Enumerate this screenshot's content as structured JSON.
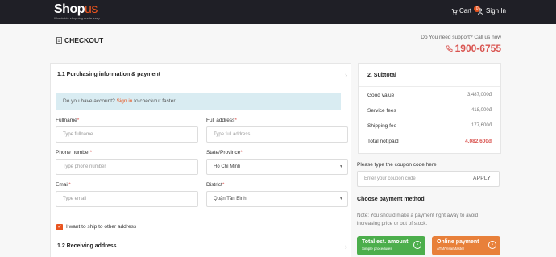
{
  "header": {
    "logo_main": "Sh",
    "logo_o": "o",
    "logo_p": "p",
    "logo_us": "us",
    "tagline": "Worldwide shopping made easy",
    "cart_label": "Cart",
    "cart_count": "0",
    "signin_label": "Sign In"
  },
  "page": {
    "title": "CHECKOUT",
    "support_text": "Do You need support? Call us now",
    "hotline": "1900-6755"
  },
  "purchasing": {
    "heading": "1.1 Purchasing information & payment",
    "alert_prefix": "Do you have account?",
    "alert_link": "Sign in",
    "alert_suffix": "to checkout faster",
    "fullname_label": "Fullname",
    "fullname_placeholder": "Type fullname",
    "address_label": "Full address",
    "address_placeholder": "Type full address",
    "phone_label": "Phone number",
    "phone_placeholder": "Type phone number",
    "state_label": "State/Province",
    "state_value": "Hồ Chí Minh",
    "email_label": "Email",
    "email_placeholder": "Type email",
    "district_label": "District",
    "district_value": "Quận Tân Bình",
    "ship_other_label": "I want to ship to other address",
    "required_mark": "*"
  },
  "receiving": {
    "heading": "1.2 Receiving address"
  },
  "subtotal": {
    "title": "2. Subtotal",
    "rows": [
      {
        "label": "Good value",
        "value": "3,487,000đ"
      },
      {
        "label": "Service fees",
        "value": "418,000đ"
      },
      {
        "label": "Shipping fee",
        "value": "177,600đ"
      },
      {
        "label": "Total not paid",
        "value": "4,082,600đ"
      }
    ]
  },
  "coupon": {
    "label": "Please type the coupon code here",
    "placeholder": "Enter your coupon code",
    "apply_label": "APPLY"
  },
  "payment": {
    "title": "Choose payment method",
    "note": "Note: You should make a payment right away to avoid increasing price or out of stock.",
    "option1_title": "Total est. amount",
    "option1_sub": "Simple procedures",
    "option2_title": "Online payment",
    "option2_sub": "ATM/Visa/Master",
    "green": "#4cae4c",
    "orange": "#e8803a"
  },
  "colors": {
    "accent": "#e9541f",
    "topbar": "#1f1f26",
    "price_red": "#d9534f"
  }
}
